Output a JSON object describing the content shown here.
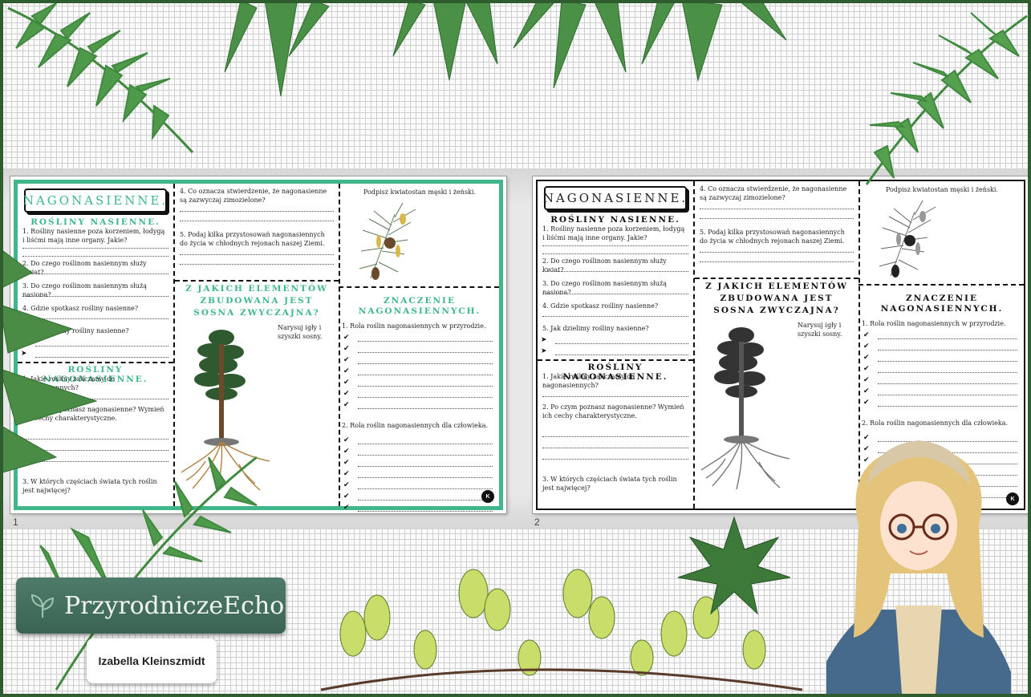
{
  "colors": {
    "accent": "#3fb78a",
    "leaf": "#3f8a3f",
    "frame": "#2f5d2f",
    "brand_bg": "#3a6354"
  },
  "slides": [
    {
      "number": "1",
      "title": "NAGONASIENNE.",
      "seed_heading": "ROŚLINY NASIENNE.",
      "seed_q1": "1. Rośliny nasienne poza korzeniem, łodygą i liśćmi mają inne organy. Jakie?",
      "seed_q2": "2. Do czego roślinom nasiennym służy kwiat?",
      "seed_q3": "3. Do czego roślinom nasiennym służą nasiona?",
      "seed_q4": "4. Gdzie spotkasz rośliny nasienne?",
      "seed_q5": "5. Jak dzielimy rośliny nasienne?",
      "gymno_heading": "ROŚLINY NAGONASIENNE.",
      "gymno_q1": "1. Jakie rośliny zaliczamy do nagonasiennych?",
      "gymno_q2": "2. Po czym poznasz nagonasienne? Wymień ich cechy charakterystyczne.",
      "gymno_q3": "3. W których częściach świata tych roślin jest najwięcej?",
      "mid_q4": "4. Co oznacza stwierdzenie, że nagonasienne są zazwyczaj zimozielone?",
      "mid_q5": "5. Podaj kilka przystosowań nagonasiennych do życia w chłodnych rejonach naszej Ziemi.",
      "pine_heading": "Z JAKICH ELEMENTÓW ZBUDOWANA JEST SOSNA ZWYCZAJNA?",
      "pine_note": "Narysuj igły i szyszki sosny.",
      "flower_caption": "Podpisz kwiatostan męski i żeński.",
      "meaning_heading": "ZNACZENIE NAGONASIENNYCH.",
      "meaning_q1": "1. Rola roślin nagonasiennych w przyrodzie.",
      "meaning_q2": "2. Rola roślin nagonasiennych dla człowieka.",
      "badge": "K"
    },
    {
      "number": "2",
      "title": "NAGONASIENNE.",
      "seed_heading": "ROŚLINY NASIENNE.",
      "seed_q1": "1. Rośliny nasienne poza korzeniem, łodygą i liśćmi mają inne organy. Jakie?",
      "seed_q2": "2. Do czego roślinom nasiennym służy kwiat?",
      "seed_q3": "3. Do czego roślinom nasiennym służą nasiona?",
      "seed_q4": "4. Gdzie spotkasz rośliny nasienne?",
      "seed_q5": "5. Jak dzielimy rośliny nasienne?",
      "gymno_heading": "ROŚLINY NAGONASIENNE.",
      "gymno_q1": "1. Jakie rośliny zaliczamy do nagonasiennych?",
      "gymno_q2": "2. Po czym poznasz nagonasienne? Wymień ich cechy charakterystyczne.",
      "gymno_q3": "3. W których częściach świata tych roślin jest najwięcej?",
      "mid_q4": "4. Co oznacza stwierdzenie, że nagonasienne są zazwyczaj zimozielone?",
      "mid_q5": "5. Podaj kilka przystosowań nagonasiennych do życia w chłodnych rejonach naszej Ziemi.",
      "pine_heading": "Z JAKICH ELEMENTÓW ZBUDOWANA JEST SOSNA ZWYCZAJNA?",
      "pine_note": "Narysuj igły i szyszki sosny.",
      "flower_caption": "Podpisz kwiatostan męski i żeński.",
      "meaning_heading": "ZNACZENIE NAGONASIENNYCH.",
      "meaning_q1": "1. Rola roślin nagonasiennych w przyrodzie.",
      "meaning_q2": "2. Rola roślin nagonasiennych dla człowieka.",
      "badge": "K"
    }
  ],
  "brand": {
    "name": "PrzyrodniczeEcho",
    "icon": "sprout-icon"
  },
  "author": {
    "name": "Izabella Kleinszmidt"
  },
  "illustrations": {
    "girl": "cartoon-girl-with-glasses-icon",
    "ferns": "fern-leaf-icon"
  }
}
